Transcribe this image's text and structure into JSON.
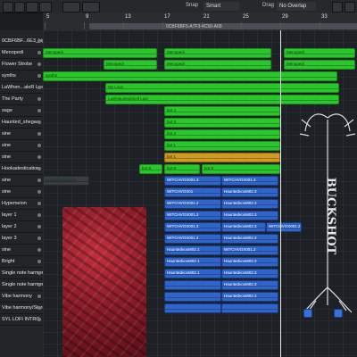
{
  "toolbar": {
    "snap_label": "Snap",
    "snap_value": "Smart",
    "drag_label": "Drag",
    "drag_value": "No Overlap"
  },
  "ruler": {
    "bars": [
      "5",
      "9",
      "13",
      "17",
      "21",
      "25",
      "29",
      "33",
      "37"
    ]
  },
  "arrange": {
    "file_label": "0CBF6BF5-A7F3-4C50-A09",
    "track_headers": [
      "0CBF6BF...6E3_bip",
      "Menopedi",
      "Flower Strobe",
      "synths",
      "LaWhen...aleR Last",
      "The Party",
      "sage",
      "Haunted_shegaw",
      "sine",
      "sine",
      "sine",
      "Hookadestication",
      "sine",
      "sine",
      "Hypemeion",
      "layer 1",
      "layer 2",
      "layer 3",
      "sine",
      "Bright",
      "Single note harmony",
      "Single note harmony",
      "Vibe harmony",
      "Vibe harmony/Stereo",
      "SYL LOFI INTRO"
    ],
    "regions": [
      {
        "label": "Menopedi",
        "color": "green",
        "track": 1,
        "start": 0,
        "len": 128
      },
      {
        "label": "Menopedi",
        "color": "green",
        "track": 1,
        "start": 136,
        "len": 120
      },
      {
        "label": "Menopedi",
        "color": "green",
        "track": 1,
        "start": 270,
        "len": 80
      },
      {
        "label": "Menopedi",
        "color": "green",
        "track": 2,
        "start": 68,
        "len": 60
      },
      {
        "label": "Menopedi",
        "color": "green",
        "track": 2,
        "start": 136,
        "len": 120
      },
      {
        "label": "Menopedi",
        "color": "green",
        "track": 2,
        "start": 270,
        "len": 80
      },
      {
        "label": "synths",
        "color": "green",
        "track": 3,
        "start": 0,
        "len": 330
      },
      {
        "label": "My Love",
        "color": "green",
        "track": 4,
        "start": 70,
        "len": 262
      },
      {
        "label": "LastHauntedshelf Last",
        "color": "green",
        "track": 5,
        "start": 70,
        "len": 262
      },
      {
        "label": "bot 4",
        "color": "green",
        "track": 6,
        "start": 136,
        "len": 130
      },
      {
        "label": "bot 3",
        "color": "green",
        "track": 7,
        "start": 136,
        "len": 130
      },
      {
        "label": "bot 2",
        "color": "green",
        "track": 8,
        "start": 136,
        "len": 130
      },
      {
        "label": "bot 1",
        "color": "green",
        "track": 9,
        "start": 136,
        "len": 130
      },
      {
        "label": "bot 1",
        "color": "gold",
        "track": 10,
        "start": 136,
        "len": 130
      },
      {
        "label": "bot 8",
        "color": "green",
        "track": 11,
        "start": 108,
        "len": 26
      },
      {
        "label": "bot 8",
        "color": "green",
        "track": 11,
        "start": 136,
        "len": 40
      },
      {
        "label": "bot 8",
        "color": "green",
        "track": 11,
        "start": 178,
        "len": 88
      },
      {
        "label": "Hookadestication",
        "color": "dark",
        "track": 12,
        "start": 0,
        "len": 52
      },
      {
        "label": "WITCHVOX001.3",
        "color": "blue",
        "track": 12,
        "start": 136,
        "len": 64
      },
      {
        "label": "WITCHVOX001.3",
        "color": "blue",
        "track": 12,
        "start": 200,
        "len": 64
      },
      {
        "label": "WITCHVOX01",
        "color": "blue",
        "track": 13,
        "start": 136,
        "len": 64
      },
      {
        "label": "HauntedvoxM02.3",
        "color": "blue",
        "track": 13,
        "start": 200,
        "len": 64
      },
      {
        "label": "WITCHVOX001.2",
        "color": "blue",
        "track": 14,
        "start": 136,
        "len": 64
      },
      {
        "label": "HauntedvoxM02.3",
        "color": "blue",
        "track": 14,
        "start": 200,
        "len": 64
      },
      {
        "label": "WITCHVOX001.2",
        "color": "blue",
        "track": 15,
        "start": 136,
        "len": 64
      },
      {
        "label": "HauntedvoxM02.3",
        "color": "blue",
        "track": 15,
        "start": 200,
        "len": 64
      },
      {
        "label": "WITCHVOX001.2",
        "color": "blue",
        "track": 16,
        "start": 136,
        "len": 64
      },
      {
        "label": "HauntedvoxM02.3",
        "color": "blue",
        "track": 16,
        "start": 200,
        "len": 50
      },
      {
        "label": "WITCHVOX001.2",
        "color": "blue",
        "track": 16,
        "start": 250,
        "len": 40
      },
      {
        "label": "WITCHVOX001.2",
        "color": "blue",
        "track": 17,
        "start": 136,
        "len": 64
      },
      {
        "label": "HauntedvoxM02.3",
        "color": "blue",
        "track": 17,
        "start": 200,
        "len": 64
      },
      {
        "label": "HauntedvoxM02.1",
        "color": "blue",
        "track": 18,
        "start": 136,
        "len": 64
      },
      {
        "label": "WITCHVOX001.2",
        "color": "blue",
        "track": 18,
        "start": 200,
        "len": 64
      },
      {
        "label": "HauntedvoxM02.1",
        "color": "blue",
        "track": 19,
        "start": 136,
        "len": 64
      },
      {
        "label": "HauntedvoxM02.3",
        "color": "blue",
        "track": 19,
        "start": 200,
        "len": 64
      },
      {
        "label": "HauntedvoxM02.1",
        "color": "blue",
        "track": 20,
        "start": 136,
        "len": 64
      },
      {
        "label": "HauntedvoxM02.3",
        "color": "blue",
        "track": 20,
        "start": 200,
        "len": 64
      },
      {
        "label": "",
        "color": "blue",
        "track": 21,
        "start": 136,
        "len": 64
      },
      {
        "label": "HauntedvoxM02.3",
        "color": "blue",
        "track": 21,
        "start": 200,
        "len": 64
      },
      {
        "label": "",
        "color": "blue",
        "track": 22,
        "start": 136,
        "len": 64
      },
      {
        "label": "HauntedvoxM02.3",
        "color": "blue",
        "track": 22,
        "start": 200,
        "len": 64
      },
      {
        "label": "",
        "color": "blue",
        "track": 23,
        "start": 136,
        "len": 64
      },
      {
        "label": "",
        "color": "blue",
        "track": 23,
        "start": 200,
        "len": 64
      }
    ]
  },
  "artwork": {
    "logo_text": "BUCKSHOT"
  },
  "colors": {
    "green": "#2bc62b",
    "gold": "#d19a22",
    "blue": "#2f64c9",
    "background": "#1d2024"
  }
}
